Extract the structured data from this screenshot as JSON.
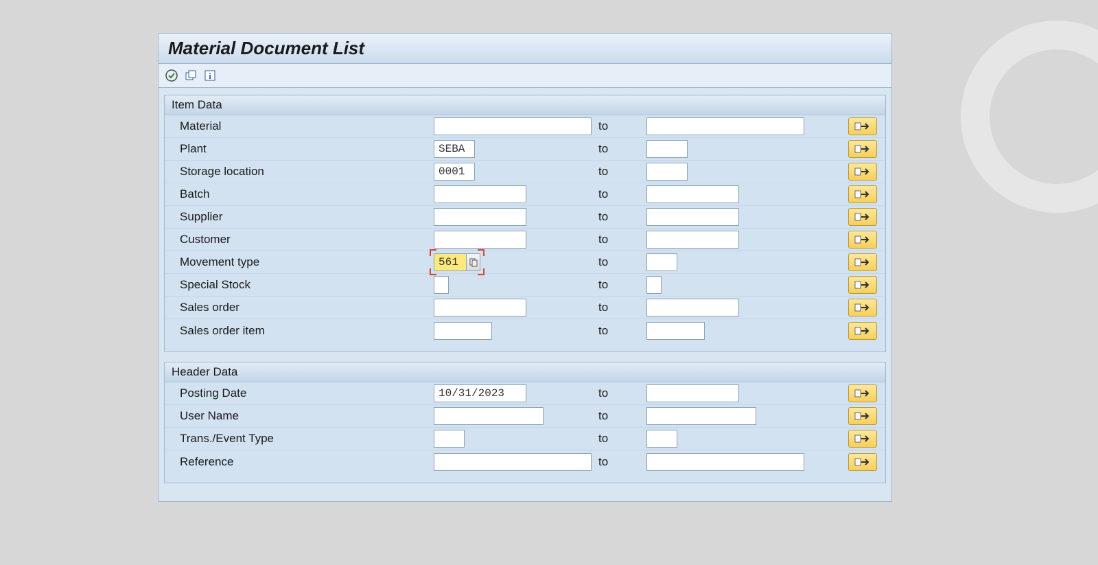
{
  "title": "Material Document List",
  "toolbar_icons": [
    "execute",
    "variants",
    "info"
  ],
  "groups": [
    {
      "header": "Item Data",
      "key": "item",
      "rows": [
        {
          "label": "Material",
          "from": "",
          "to": "",
          "from_w": "w-lg",
          "to_w": "w-lg"
        },
        {
          "label": "Plant",
          "from": "SEBA",
          "to": "",
          "from_w": "w-sm",
          "to_w": "w-sm"
        },
        {
          "label": "Storage location",
          "from": "0001",
          "to": "",
          "from_w": "w-sm",
          "to_w": "w-sm"
        },
        {
          "label": "Batch",
          "from": "",
          "to": "",
          "from_w": "w-md",
          "to_w": "w-md"
        },
        {
          "label": "Supplier",
          "from": "",
          "to": "",
          "from_w": "w-md",
          "to_w": "w-md"
        },
        {
          "label": "Customer",
          "from": "",
          "to": "",
          "from_w": "w-md",
          "to_w": "w-md"
        },
        {
          "label": "Movement type",
          "from": "561",
          "to": "",
          "from_w": "w-xs",
          "to_w": "w-xs",
          "focused": true,
          "has_f4": true
        },
        {
          "label": "Special Stock",
          "from": "",
          "to": "",
          "from_w": "w-ss",
          "to_w": "w-ss"
        },
        {
          "label": "Sales order",
          "from": "",
          "to": "",
          "from_w": "w-md",
          "to_w": "w-md"
        },
        {
          "label": "Sales order item",
          "from": "",
          "to": "",
          "from_w": "w-num",
          "to_w": "w-num"
        }
      ]
    },
    {
      "header": "Header Data",
      "key": "header",
      "rows": [
        {
          "label": "Posting Date",
          "from": "10/31/2023",
          "to": "",
          "from_w": "w-date",
          "to_w": "w-date"
        },
        {
          "label": "User Name",
          "from": "",
          "to": "",
          "from_w": "w-name",
          "to_w": "w-name"
        },
        {
          "label": "Trans./Event Type",
          "from": "",
          "to": "",
          "from_w": "w-xs",
          "to_w": "w-xs"
        },
        {
          "label": "Reference",
          "from": "",
          "to": "",
          "from_w": "w-lg",
          "to_w": "w-lg"
        }
      ]
    }
  ],
  "to_label": "to"
}
